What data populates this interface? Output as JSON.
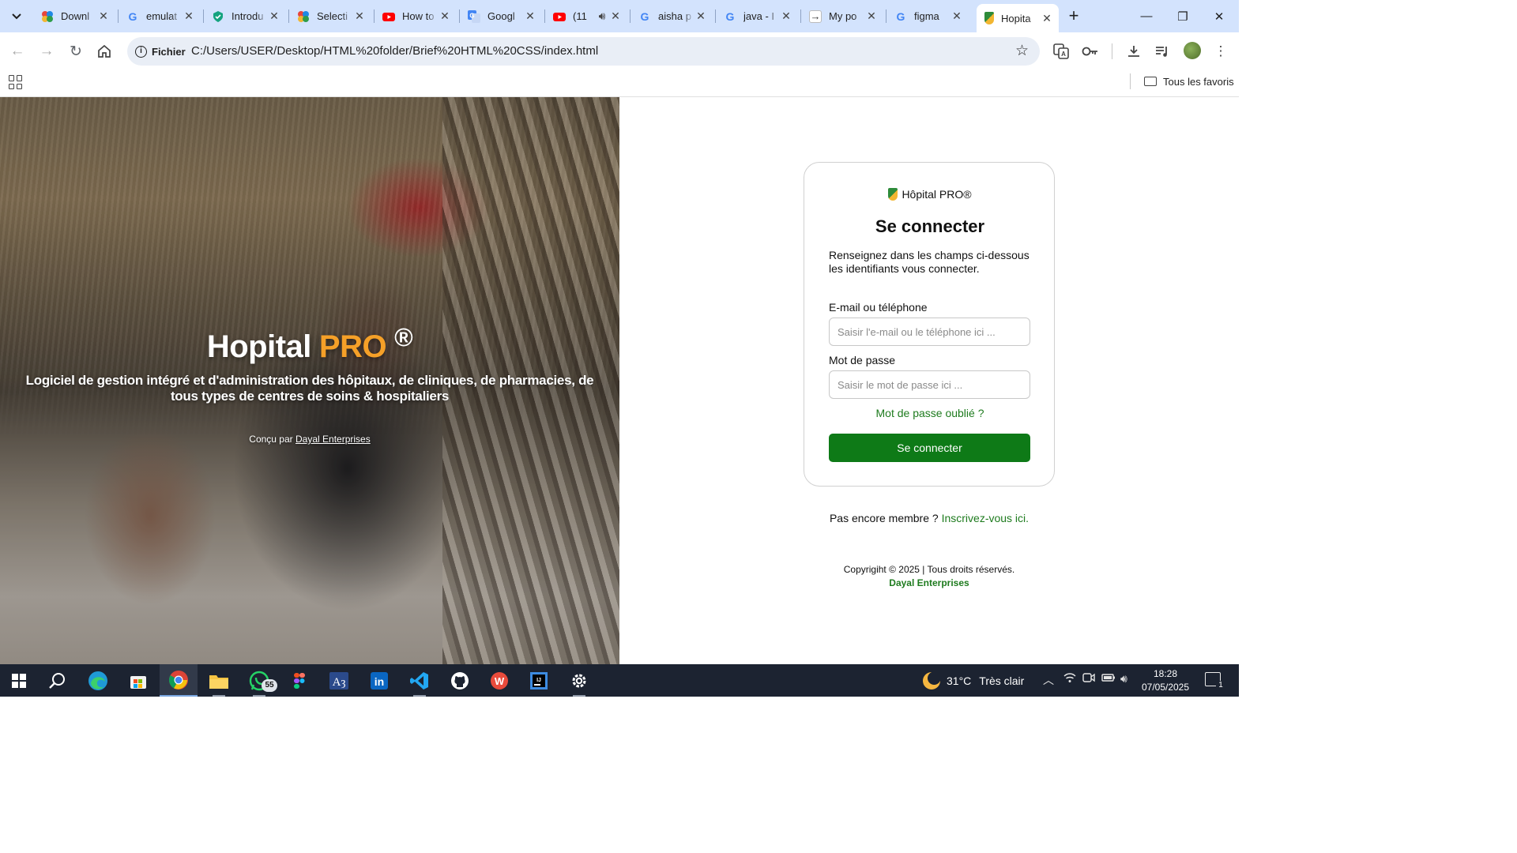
{
  "browser": {
    "tabs": [
      {
        "label": "Downl",
        "favicon": "figma-like-icon",
        "color": "#e8453c"
      },
      {
        "label": "emulat",
        "favicon": "google-icon",
        "color": "#4285f4"
      },
      {
        "label": "Introdu",
        "favicon": "shield-check-icon",
        "color": "#14a37f"
      },
      {
        "label": "Selecti",
        "favicon": "figma-like-icon",
        "color": "#e8453c"
      },
      {
        "label": "How to",
        "favicon": "youtube-icon",
        "color": "#ff0000"
      },
      {
        "label": "Googl",
        "favicon": "google-translate-icon",
        "color": "#4285f4"
      },
      {
        "label": "(11",
        "favicon": "youtube-icon",
        "color": "#ff0000"
      },
      {
        "label": "aisha p",
        "favicon": "google-icon",
        "color": "#4285f4"
      },
      {
        "label": "java - I",
        "favicon": "google-icon",
        "color": "#4285f4"
      },
      {
        "label": "My po",
        "favicon": "arrow-icon",
        "color": "#555555"
      },
      {
        "label": "figma",
        "favicon": "google-icon",
        "color": "#4285f4"
      },
      {
        "label": "Hopita",
        "favicon": "hospital-logo-icon",
        "color": "#2e8b3a",
        "active": true
      }
    ],
    "address": {
      "chip_label": "Fichier",
      "url": "C:/Users/USER/Desktop/HTML%20folder/Brief%20HTML%20CSS/index.html"
    },
    "bookmarks": {
      "all_favorites": "Tous les favoris"
    }
  },
  "hero": {
    "title_main": "Hopital",
    "title_accent": "PRO",
    "title_mark": "®",
    "subtitle": "Logiciel de gestion intégré et d'administration des hôpitaux, de cliniques, de pharmacies, de tous types de centres de soins & hospitaliers",
    "credit_prefix": "Conçu par",
    "credit_link": "Dayal Enterprises",
    "accent_color": "#f5a028"
  },
  "login": {
    "brand": "Hôpital PRO®",
    "heading": "Se connecter",
    "description": "Renseignez dans les champs ci-dessous les identifiants vous connecter.",
    "email_label": "E-mail ou téléphone",
    "email_placeholder": "Saisir l'e-mail ou le téléphone ici ...",
    "password_label": "Mot de passe",
    "password_placeholder": "Saisir le mot de passe ici ...",
    "forgot": "Mot de passe oublié ?",
    "submit": "Se connecter",
    "primary_color": "#0e7a17"
  },
  "signup": {
    "prompt": "Pas encore membre ?",
    "link": "Inscrivez-vous ici."
  },
  "footer": {
    "copyright": "Copyrigiht © 2025 | Tous droits réservés.",
    "company": "Dayal Enterprises"
  },
  "taskbar": {
    "whatsapp_badge": "55",
    "weather_temp": "31°C",
    "weather_desc": "Très clair",
    "time": "18:28",
    "date": "07/05/2025",
    "notifications": "1"
  }
}
